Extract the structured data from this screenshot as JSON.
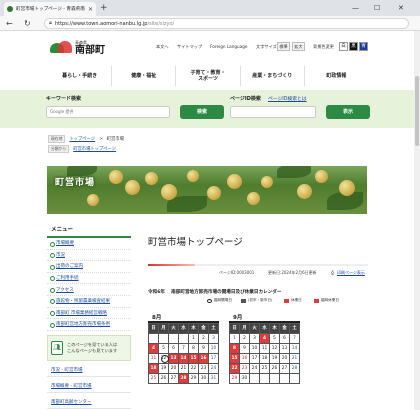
{
  "browser": {
    "tab_title": "町営市場トップページ - 青森県南部町",
    "new_tab": "+",
    "url_host": "https://www.town.aomori-nanbu.lg.jp",
    "url_path": "/site/sizyo/",
    "win_min": "—",
    "win_max": "☐",
    "win_close": "✕"
  },
  "header": {
    "logo_small": "青森県",
    "logo_big": "南部町",
    "util_links": [
      "本文へ",
      "サイトマップ",
      "Foreign Language"
    ],
    "font_size_label": "文字サイズ",
    "font_std": "標準",
    "font_big": "拡大",
    "color_label": "背景色変更",
    "color_white": "白",
    "color_black": "黒",
    "color_blue": "青"
  },
  "gnav": [
    "暮らし・手続き",
    "健康・福祉",
    "子育て・教育・\nスポーツ",
    "産業・まちづくり",
    "町政情報"
  ],
  "search": {
    "keyword_label": "キーワード検索",
    "keyword_placeholder": "Google 提供",
    "keyword_button": "検索",
    "pageid_label": "ページID検索",
    "pageid_link": "ページID検索とは",
    "pageid_button": "表示"
  },
  "breadcrumb": {
    "current_tag": "現在地",
    "home": "トップページ",
    "sep": ">",
    "here": "町営市場",
    "category_tag": "分類から",
    "category": "町営市場トップページ"
  },
  "banner": {
    "title": "町営市場"
  },
  "sidebar": {
    "menu_title": "メニュー",
    "items": [
      "市場概要",
      "市況",
      "出荷のご案内",
      "ご利用手続",
      "アクセス",
      "旅館物・残留農薬検査結果",
      "南部町 市場業務経営戦略",
      "南部町営地方卸売市場条例"
    ],
    "box_text": "このページを見ている人は\nこんなページも見ています",
    "links": [
      "市況 - 町営市場",
      "市場概要 - 町営市場",
      "南部町高齢センター"
    ]
  },
  "main": {
    "title": "町営市場トップページ",
    "page_id": "ページID:0003001",
    "updated": "更新日:2024年2月6日更新",
    "print": "印刷ページ表示",
    "cal_title": "令和6年　 南部町営地方卸売市場の開場日及び休業日カレンダー",
    "legend": [
      "臨時開場日",
      "(初市・新市日)",
      "休業日",
      "臨時休業日"
    ],
    "legend_colors": [
      "#ffffff",
      "#555555",
      "#e03a3a",
      "#e03a3a"
    ]
  },
  "calendars": [
    {
      "month": "8月",
      "days": [
        "日",
        "月",
        "火",
        "水",
        "木",
        "金",
        "土"
      ],
      "cells": [
        {
          "t": "",
          "k": ""
        },
        {
          "t": "",
          "k": ""
        },
        {
          "t": "",
          "k": ""
        },
        {
          "t": "",
          "k": ""
        },
        {
          "t": "1",
          "k": ""
        },
        {
          "t": "2",
          "k": ""
        },
        {
          "t": "3",
          "k": "sat"
        },
        {
          "t": "4",
          "k": "red"
        },
        {
          "t": "5",
          "k": ""
        },
        {
          "t": "6",
          "k": ""
        },
        {
          "t": "7",
          "k": ""
        },
        {
          "t": "8",
          "k": ""
        },
        {
          "t": "9",
          "k": ""
        },
        {
          "t": "10",
          "k": "sat"
        },
        {
          "t": "11",
          "k": "sun"
        },
        {
          "t": "12",
          "k": "circ"
        },
        {
          "t": "13",
          "k": "red"
        },
        {
          "t": "14",
          "k": "red"
        },
        {
          "t": "15",
          "k": "red"
        },
        {
          "t": "16",
          "k": "red"
        },
        {
          "t": "17",
          "k": "sat"
        },
        {
          "t": "18",
          "k": "red"
        },
        {
          "t": "19",
          "k": ""
        },
        {
          "t": "20",
          "k": ""
        },
        {
          "t": "21",
          "k": ""
        },
        {
          "t": "22",
          "k": ""
        },
        {
          "t": "23",
          "k": ""
        },
        {
          "t": "24",
          "k": "sat"
        },
        {
          "t": "25",
          "k": "sun"
        },
        {
          "t": "26",
          "k": ""
        },
        {
          "t": "27",
          "k": ""
        },
        {
          "t": "28",
          "k": "red"
        },
        {
          "t": "29",
          "k": ""
        },
        {
          "t": "30",
          "k": ""
        },
        {
          "t": "31",
          "k": "sat"
        }
      ]
    },
    {
      "month": "9月",
      "days": [
        "日",
        "月",
        "火",
        "水",
        "木",
        "金",
        "土"
      ],
      "cells": [
        {
          "t": "1",
          "k": "sun"
        },
        {
          "t": "2",
          "k": ""
        },
        {
          "t": "3",
          "k": ""
        },
        {
          "t": "4",
          "k": "red"
        },
        {
          "t": "5",
          "k": ""
        },
        {
          "t": "6",
          "k": ""
        },
        {
          "t": "7",
          "k": "sat"
        },
        {
          "t": "8",
          "k": "red"
        },
        {
          "t": "9",
          "k": ""
        },
        {
          "t": "10",
          "k": ""
        },
        {
          "t": "11",
          "k": ""
        },
        {
          "t": "12",
          "k": ""
        },
        {
          "t": "13",
          "k": ""
        },
        {
          "t": "14",
          "k": "sat"
        },
        {
          "t": "15",
          "k": "red"
        },
        {
          "t": "16",
          "k": "sun"
        },
        {
          "t": "17",
          "k": ""
        },
        {
          "t": "18",
          "k": ""
        },
        {
          "t": "19",
          "k": ""
        },
        {
          "t": "20",
          "k": ""
        },
        {
          "t": "21",
          "k": "sat"
        },
        {
          "t": "22",
          "k": "red"
        },
        {
          "t": "23",
          "k": "sun"
        },
        {
          "t": "24",
          "k": ""
        },
        {
          "t": "25",
          "k": ""
        },
        {
          "t": "26",
          "k": ""
        },
        {
          "t": "27",
          "k": ""
        },
        {
          "t": "28",
          "k": "sat"
        },
        {
          "t": "29",
          "k": "sun"
        },
        {
          "t": "30",
          "k": ""
        },
        {
          "t": "",
          "k": ""
        },
        {
          "t": "",
          "k": ""
        },
        {
          "t": "",
          "k": ""
        },
        {
          "t": "",
          "k": ""
        },
        {
          "t": "",
          "k": ""
        }
      ]
    }
  ]
}
